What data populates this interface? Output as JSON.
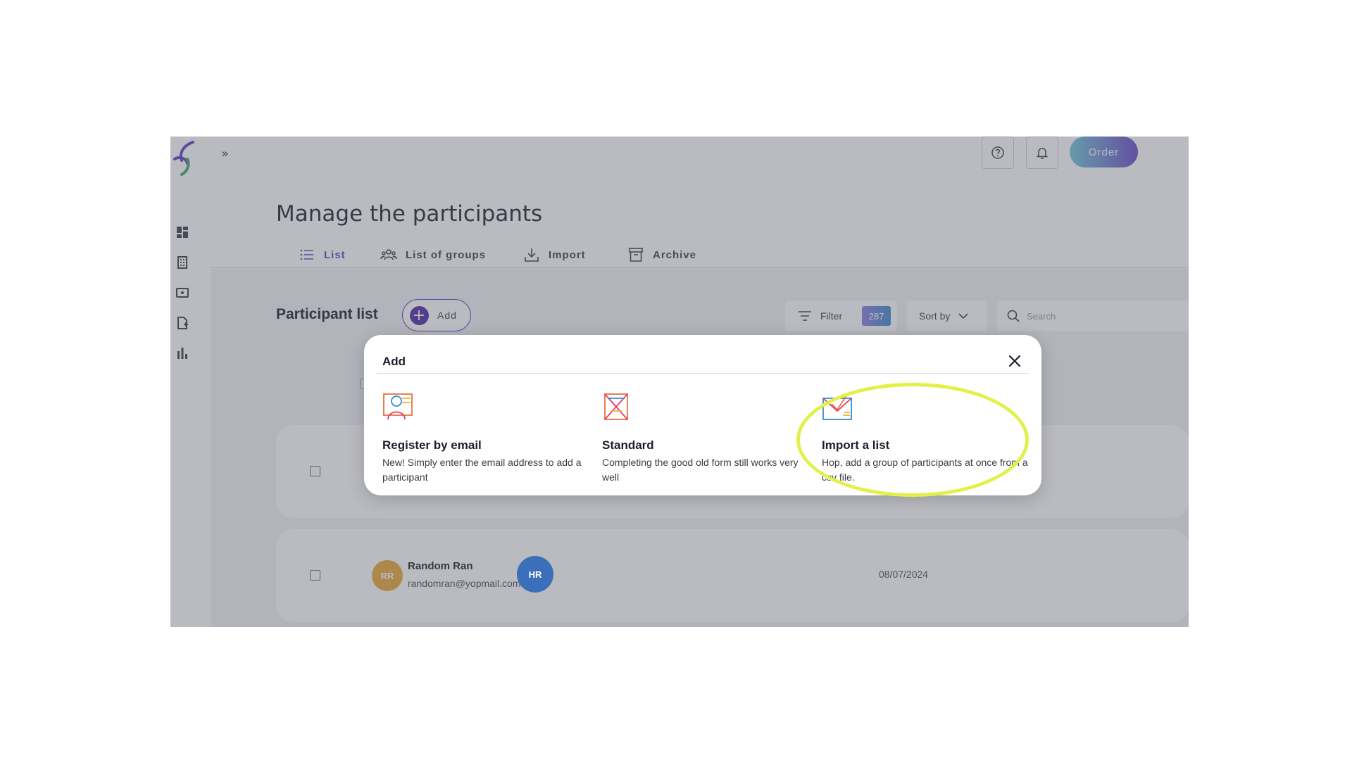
{
  "header": {
    "title": "Manage the participants",
    "order_label": "Order"
  },
  "tabs": [
    {
      "label": "List",
      "icon": "list-icon",
      "active": true
    },
    {
      "label": "List of groups",
      "icon": "groups-icon"
    },
    {
      "label": "Import",
      "icon": "import-icon"
    },
    {
      "label": "Archive",
      "icon": "archive-icon"
    }
  ],
  "toolbar": {
    "title": "Participant list",
    "add_label": "Add",
    "filter_label": "Filter",
    "filter_count": "287",
    "sort_label": "Sort by",
    "search_placeholder": "Search"
  },
  "rows": [
    {
      "initials": "RR",
      "name": "Random Ran",
      "email": "randomran@yopmail.com",
      "second_initials": "HR",
      "date": "08/07/2024"
    }
  ],
  "modal": {
    "title": "Add",
    "options": [
      {
        "title": "Register by email",
        "description": "New! Simply enter the email address to add a participant",
        "icon": "register-email-icon"
      },
      {
        "title": "Standard",
        "description": "Completing the good old form still works very well",
        "icon": "standard-form-icon"
      },
      {
        "title": "Import a list",
        "description": "Hop, add a group of participants at once from a csv file.",
        "icon": "import-list-icon"
      }
    ]
  },
  "colors": {
    "accent": "#5a3fc4",
    "highlight": "#e2f14a",
    "avatar_rr": "#e7a83a",
    "avatar_hr": "#3c6fb9"
  }
}
